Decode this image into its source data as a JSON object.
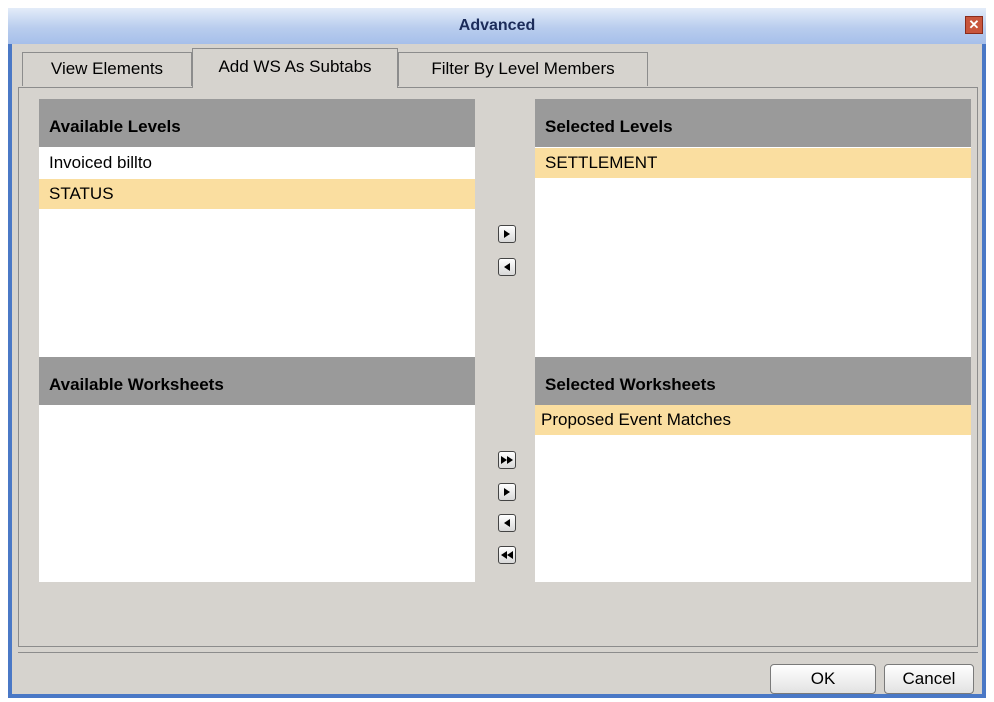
{
  "window": {
    "title": "Advanced"
  },
  "tabs": [
    {
      "label": "View Elements"
    },
    {
      "label": "Add WS As Subtabs",
      "active": true
    },
    {
      "label": "Filter By Level Members"
    }
  ],
  "available_levels": {
    "header": "Available Levels",
    "items": [
      "Invoiced billto",
      "STATUS"
    ],
    "selected_index": 1
  },
  "selected_levels": {
    "header": "Selected Levels",
    "items": [
      "SETTLEMENT"
    ],
    "selected_index": 0
  },
  "available_worksheets": {
    "header": "Available Worksheets",
    "items": []
  },
  "selected_worksheets": {
    "header": "Selected Worksheets",
    "items": [
      "Proposed Event Matches"
    ],
    "selected_index": 0
  },
  "buttons": {
    "ok": "OK",
    "cancel": "Cancel"
  },
  "colors": {
    "title_bar": "#b9cdee",
    "selection": "#fadea0",
    "panel_header": "#9a9a9a",
    "dialog_bg": "#d6d3ce"
  },
  "icons": [
    "close-icon",
    "move-right-icon",
    "move-left-icon",
    "move-all-right-icon",
    "move-all-left-icon"
  ]
}
